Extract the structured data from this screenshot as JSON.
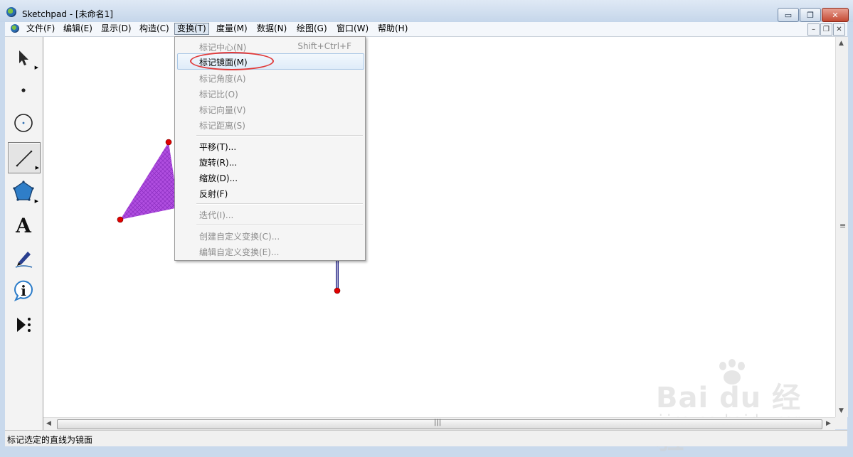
{
  "window": {
    "title": "Sketchpad  - [未命名1]",
    "minimize": "▭",
    "restore": "❐",
    "close": "✕"
  },
  "menubar": {
    "items": [
      {
        "label": "文件(F)"
      },
      {
        "label": "编辑(E)"
      },
      {
        "label": "显示(D)"
      },
      {
        "label": "构造(C)"
      },
      {
        "label": "变换(T)"
      },
      {
        "label": "度量(M)"
      },
      {
        "label": "数据(N)"
      },
      {
        "label": "绘图(G)"
      },
      {
        "label": "窗口(W)"
      },
      {
        "label": "帮助(H)"
      }
    ],
    "active_menu": "变换(T)"
  },
  "toolbox": {
    "tools": [
      {
        "name": "arrow-select-tool",
        "icon": "arrow-pointer-icon"
      },
      {
        "name": "point-tool",
        "icon": "dot-icon"
      },
      {
        "name": "compass-tool",
        "icon": "circle-icon"
      },
      {
        "name": "straightedge-tool",
        "icon": "line-segment-icon",
        "selected": true
      },
      {
        "name": "polygon-tool",
        "icon": "pentagon-icon"
      },
      {
        "name": "text-tool",
        "icon": "text-a-icon",
        "glyph": "A"
      },
      {
        "name": "marker-tool",
        "icon": "marker-pen-icon"
      },
      {
        "name": "info-tool",
        "icon": "info-icon",
        "glyph": "i"
      },
      {
        "name": "custom-tool",
        "icon": "custom-tool-icon"
      }
    ]
  },
  "dropdown": {
    "items": [
      {
        "label": "标记中心(N)",
        "shortcut": "Shift+Ctrl+F",
        "enabled": false
      },
      {
        "label": "标记镜面(M)",
        "shortcut": "",
        "enabled": true,
        "hovered": true
      },
      {
        "label": "标记角度(A)",
        "shortcut": "",
        "enabled": false
      },
      {
        "label": "标记比(O)",
        "shortcut": "",
        "enabled": false
      },
      {
        "label": "标记向量(V)",
        "shortcut": "",
        "enabled": false
      },
      {
        "label": "标记距离(S)",
        "shortcut": "",
        "enabled": false
      },
      {
        "label": "平移(T)...",
        "shortcut": "",
        "enabled": true
      },
      {
        "label": "旋转(R)...",
        "shortcut": "",
        "enabled": true
      },
      {
        "label": "缩放(D)...",
        "shortcut": "",
        "enabled": true
      },
      {
        "label": "反射(F)",
        "shortcut": "",
        "enabled": true
      },
      {
        "label": "迭代(I)...",
        "shortcut": "",
        "enabled": false
      },
      {
        "label": "创建自定义变换(C)...",
        "shortcut": "",
        "enabled": false
      },
      {
        "label": "编辑自定义变换(E)...",
        "shortcut": "",
        "enabled": false
      }
    ]
  },
  "status": {
    "text": "标记选定的直线为镜面"
  },
  "watermark": {
    "brand": "Bai du 经验",
    "url": "jingyan.baidu.com"
  },
  "colors": {
    "polygon_fill": "#b04ee0",
    "point": "#e00000",
    "mirror_line": "#1a1a80",
    "highlight_ring": "#e03a3a"
  }
}
